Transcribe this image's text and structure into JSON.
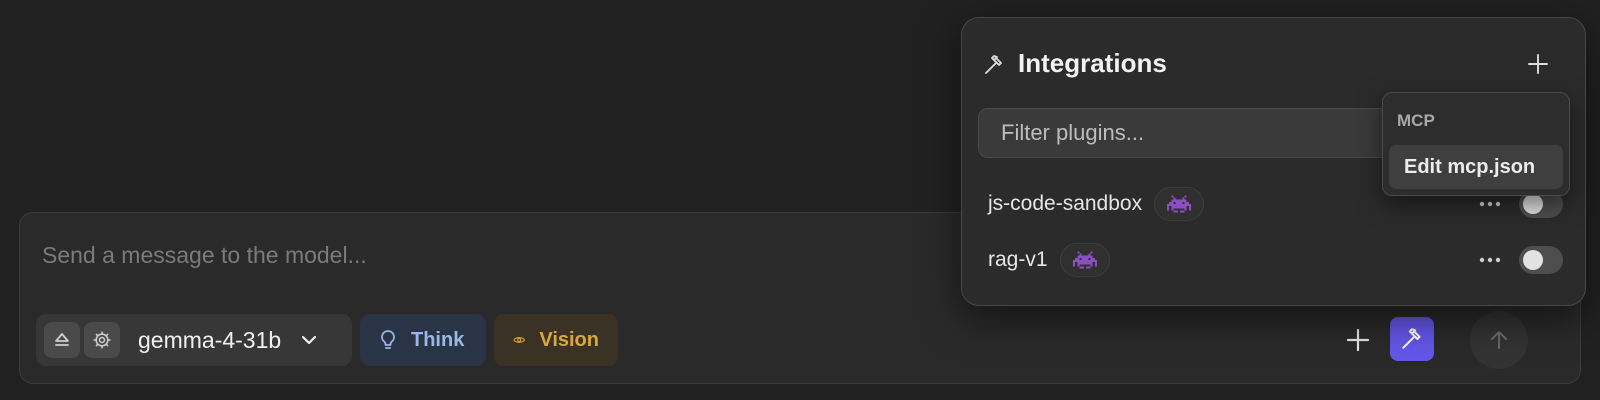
{
  "composer": {
    "placeholder": "Send a message to the model...",
    "model_name": "gemma-4-31b",
    "think_label": "Think",
    "vision_label": "Vision"
  },
  "integrations": {
    "title": "Integrations",
    "filter_placeholder": "Filter plugins...",
    "plugins": [
      {
        "name": "js-code-sandbox",
        "enabled": false
      },
      {
        "name": "rag-v1",
        "enabled": false
      }
    ]
  },
  "mcp_menu": {
    "header": "MCP",
    "items": [
      {
        "label": "Edit mcp.json"
      }
    ]
  },
  "colors": {
    "background": "#212121",
    "composer_bg": "#2a2a2a",
    "accent_tools": "#6457e8",
    "think_text": "#9ab8e6",
    "think_bg": "#293446",
    "vision_text": "#d9a83a",
    "vision_bg": "#3a3325",
    "plugin_icon": "#8a4fc0"
  },
  "icons": {
    "eject": "eject-icon",
    "gear": "gear-icon",
    "chevron": "chevron-down-icon",
    "bulb": "lightbulb-icon",
    "eye": "eye-icon",
    "plus": "plus-icon",
    "hammer": "hammer-icon",
    "arrow_up": "arrow-up-icon",
    "more": "more-horizontal-icon",
    "plugin": "space-invader-icon"
  }
}
